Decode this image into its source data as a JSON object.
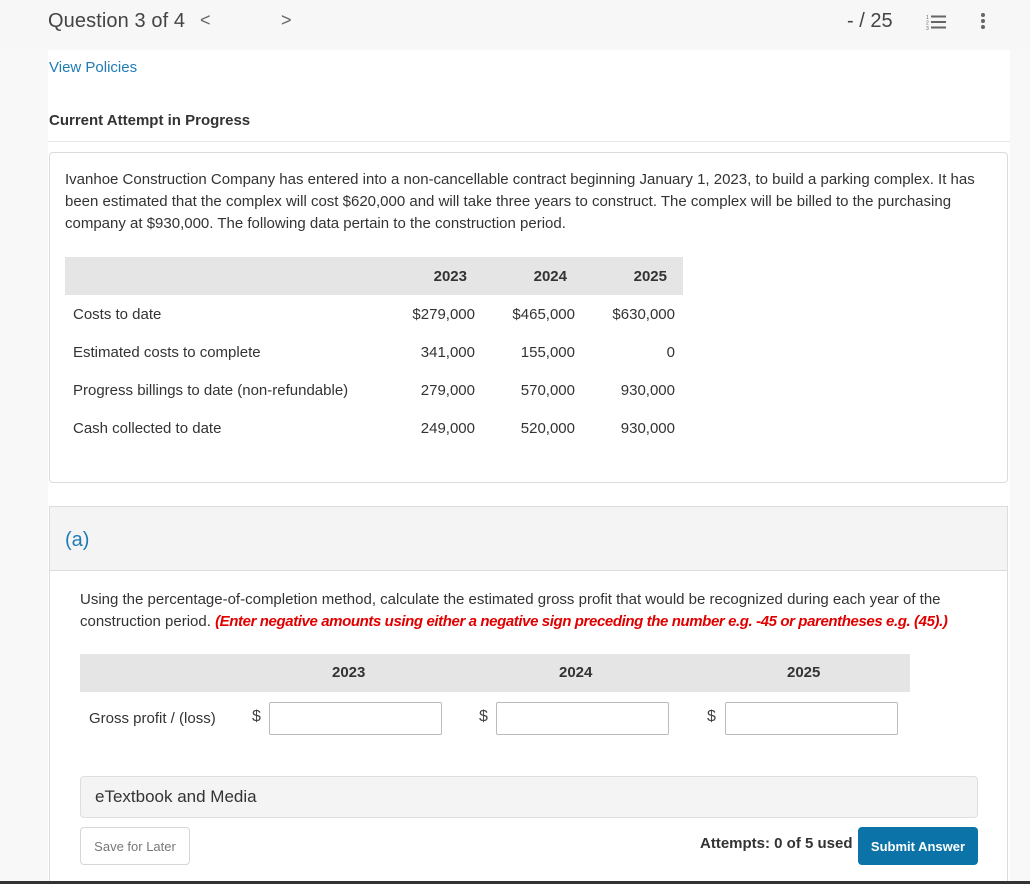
{
  "header": {
    "question_label": "Question 3 of 4",
    "prev_icon": "chevron-left-icon",
    "next_icon": "chevron-right-icon",
    "prev_glyph": "<",
    "next_glyph": ">",
    "score": "- / 25",
    "list_icon": "numbered-list-icon",
    "more_icon": "more-vertical-icon"
  },
  "links": {
    "view_policies": "View Policies"
  },
  "attempt_heading": "Current Attempt in Progress",
  "question": {
    "text": "Ivanhoe Construction Company has entered into a non-cancellable contract beginning January 1, 2023, to build a parking complex. It has been estimated that the complex will cost $620,000 and will take three years to construct. The complex will be billed to the purchasing company at $930,000. The following data pertain to the construction period.",
    "table": {
      "headers": [
        "",
        "2023",
        "2024",
        "2025"
      ],
      "rows": [
        {
          "label": "Costs to date",
          "values": [
            "$279,000",
            "$465,000",
            "$630,000"
          ]
        },
        {
          "label": "Estimated costs to complete",
          "values": [
            "341,000",
            "155,000",
            "0"
          ]
        },
        {
          "label": "Progress billings to date (non-refundable)",
          "values": [
            "279,000",
            "570,000",
            "930,000"
          ]
        },
        {
          "label": "Cash collected to date",
          "values": [
            "249,000",
            "520,000",
            "930,000"
          ]
        }
      ]
    }
  },
  "part_a": {
    "label": "(a)",
    "instructions": "Using the percentage-of-completion method, calculate the estimated gross profit that would be recognized during each year of the construction period.",
    "warning": "(Enter negative amounts using either a negative sign preceding the number e.g. -45 or parentheses e.g. (45).)",
    "columns": [
      "2023",
      "2024",
      "2025"
    ],
    "row_label": "Gross profit / (loss)",
    "currency_symbol": "$",
    "inputs": [
      {
        "year": "2023",
        "value": ""
      },
      {
        "year": "2024",
        "value": ""
      },
      {
        "year": "2025",
        "value": ""
      }
    ]
  },
  "footer": {
    "etextbook_label": "eTextbook and Media",
    "save_label": "Save for Later",
    "attempts_text": "Attempts: 0 of 5 used",
    "submit_label": "Submit Answer"
  },
  "colors": {
    "link": "#1f7bb5",
    "warning": "#e00000",
    "submit_bg": "#0b73a8"
  }
}
